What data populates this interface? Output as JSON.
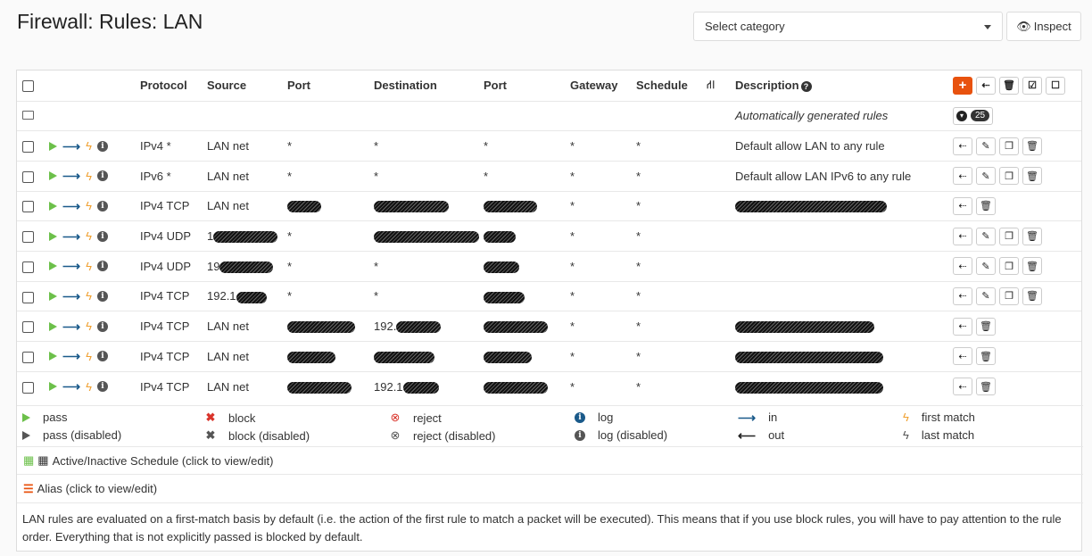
{
  "header": {
    "title": "Firewall: Rules: LAN",
    "category_placeholder": "Select category",
    "inspect_label": "Inspect"
  },
  "table": {
    "headers": {
      "protocol": "Protocol",
      "source": "Source",
      "port": "Port",
      "destination": "Destination",
      "dport": "Port",
      "gateway": "Gateway",
      "schedule": "Schedule",
      "description": "Description"
    },
    "auto_row": {
      "description": "Automatically generated rules",
      "count": "25"
    },
    "rows": [
      {
        "protocol": "IPv4 *",
        "source": "LAN net",
        "port": "*",
        "destination": "*",
        "dport": "*",
        "gateway": "*",
        "schedule": "*",
        "description": "Default allow LAN to any rule"
      },
      {
        "protocol": "IPv6 *",
        "source": "LAN net",
        "port": "*",
        "destination": "*",
        "dport": "*",
        "gateway": "*",
        "schedule": "*",
        "description": "Default allow LAN IPv6 to any rule"
      },
      {
        "protocol": "IPv4 TCP",
        "source": "LAN net",
        "port": "",
        "destination": "",
        "dport": "",
        "gateway": "*",
        "schedule": "*",
        "description": ""
      },
      {
        "protocol": "IPv4 UDP",
        "source": "1",
        "port": "*",
        "destination": "",
        "dport": "",
        "gateway": "*",
        "schedule": "*",
        "description": ""
      },
      {
        "protocol": "IPv4 UDP",
        "source": "19",
        "port": "*",
        "destination": "*",
        "dport": "",
        "gateway": "*",
        "schedule": "*",
        "description": ""
      },
      {
        "protocol": "IPv4 TCP",
        "source": "192.1",
        "port": "*",
        "destination": "*",
        "dport": "",
        "gateway": "*",
        "schedule": "*",
        "description": ""
      },
      {
        "protocol": "IPv4 TCP",
        "source": "LAN net",
        "port": "",
        "destination": "192.",
        "dport": "",
        "gateway": "*",
        "schedule": "*",
        "description": ""
      },
      {
        "protocol": "IPv4 TCP",
        "source": "LAN net",
        "port": "",
        "destination": "",
        "dport": "",
        "gateway": "*",
        "schedule": "*",
        "description": ""
      },
      {
        "protocol": "IPv4 TCP",
        "source": "LAN net",
        "port": "",
        "destination": "192.1",
        "dport": "",
        "gateway": "*",
        "schedule": "*",
        "description": ""
      }
    ]
  },
  "legend": {
    "pass": "pass",
    "pass_disabled": "pass (disabled)",
    "block": "block",
    "block_disabled": "block (disabled)",
    "reject": "reject",
    "reject_disabled": "reject (disabled)",
    "log": "log",
    "log_disabled": "log (disabled)",
    "in": "in",
    "out": "out",
    "first_match": "first match",
    "last_match": "last match"
  },
  "schedule_legend": "Active/Inactive Schedule (click to view/edit)",
  "alias_legend": "Alias (click to view/edit)",
  "note": "LAN rules are evaluated on a first-match basis by default (i.e. the action of the first rule to match a packet will be executed). This means that if you use block rules, you will have to pay attention to the rule order. Everything that is not explicitly passed is blocked by default.",
  "colors": {
    "accent": "#e8520e",
    "pass": "#6cc04a",
    "in_arrow": "#1a5a8a",
    "bolt": "#f0a030"
  }
}
